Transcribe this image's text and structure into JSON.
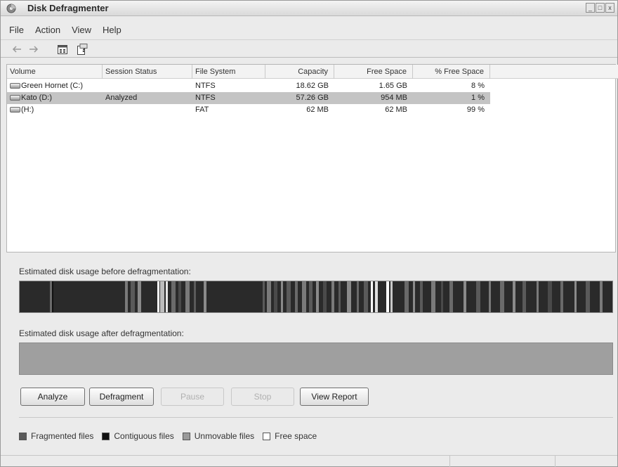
{
  "window": {
    "title": "Disk Defragmenter",
    "controls": [
      "_",
      "□",
      "x"
    ]
  },
  "menu": [
    "File",
    "Action",
    "View",
    "Help"
  ],
  "toolbar": {
    "icons": [
      "back-arrow-icon",
      "forward-arrow-icon",
      "properties-icon",
      "help-icon"
    ]
  },
  "volumes": {
    "columns": [
      "Volume",
      "Session Status",
      "File System",
      "Capacity",
      "Free Space",
      "% Free Space"
    ],
    "rows": [
      {
        "volume": "Green Hornet (C:)",
        "status": "",
        "fs": "NTFS",
        "capacity": "18.62 GB",
        "free": "1.65 GB",
        "pct": "8 %",
        "selected": false
      },
      {
        "volume": "Kato (D:)",
        "status": "Analyzed",
        "fs": "NTFS",
        "capacity": "57.26 GB",
        "free": "954 MB",
        "pct": "1 %",
        "selected": true
      },
      {
        "volume": "(H:)",
        "status": "",
        "fs": "FAT",
        "capacity": "62 MB",
        "free": "62 MB",
        "pct": "99 %",
        "selected": false
      }
    ]
  },
  "analysis": {
    "before_label": "Estimated disk usage before defragmentation:",
    "after_label": "Estimated disk usage after defragmentation:"
  },
  "buttons": {
    "analyze": "Analyze",
    "defragment": "Defragment",
    "pause": "Pause",
    "stop": "Stop",
    "view_report": "View Report"
  },
  "legend": [
    {
      "label": "Fragmented files",
      "color": "#5a5a5a"
    },
    {
      "label": "Contiguous files",
      "color": "#111111"
    },
    {
      "label": "Unmovable files",
      "color": "#9a9a9a"
    },
    {
      "label": "Free space",
      "color": "#ffffff"
    }
  ],
  "colors": {
    "selected_row": "#c4c4c4",
    "after_bar": "#9f9f9f",
    "before_bar": "#2a2a2a"
  }
}
